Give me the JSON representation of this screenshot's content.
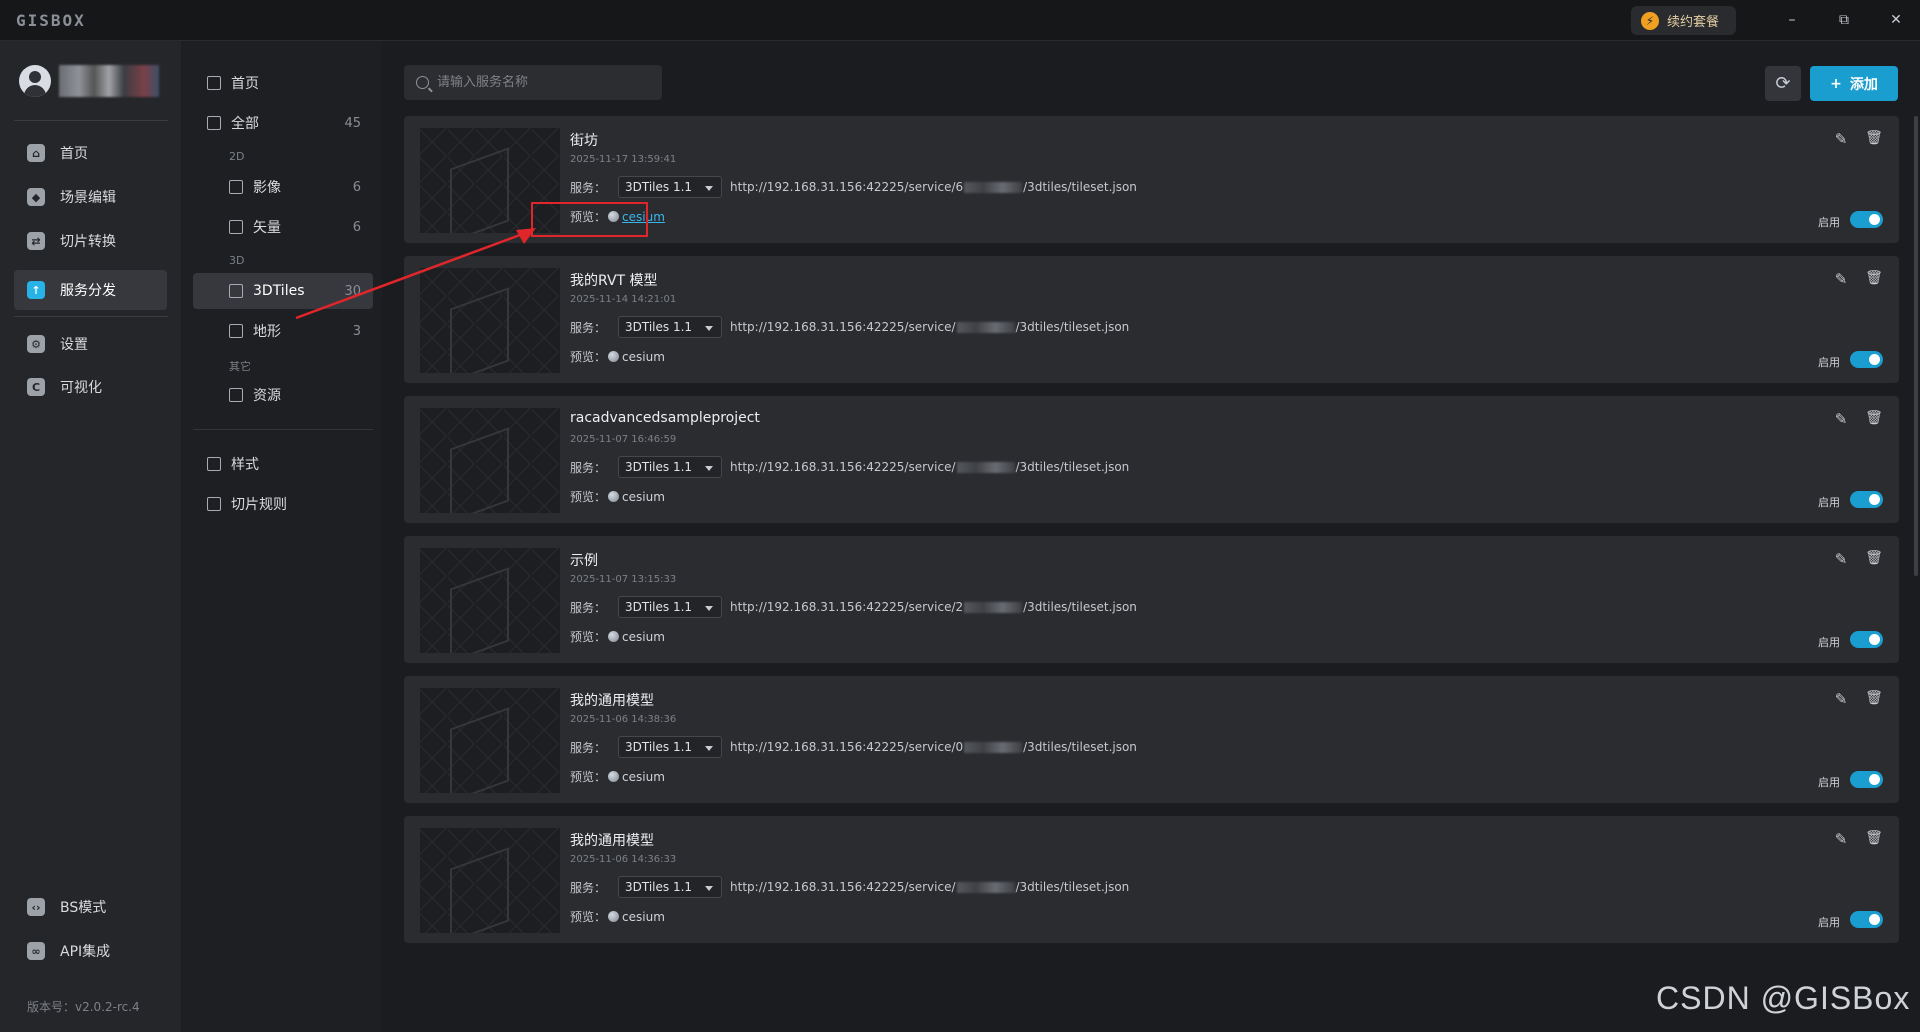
{
  "app": {
    "logo": "GISBOX",
    "renew_label": "续约套餐"
  },
  "window": {
    "minimize": "–",
    "maximize": "⧉",
    "close": "✕"
  },
  "leftnav": {
    "items": [
      {
        "label": "首页",
        "icon": "home-icon"
      },
      {
        "label": "场景编辑",
        "icon": "cube-icon"
      },
      {
        "label": "切片转换",
        "icon": "convert-icon"
      },
      {
        "label": "服务分发",
        "icon": "upload-icon"
      },
      {
        "label": "设置",
        "icon": "gear-icon"
      },
      {
        "label": "可视化",
        "icon": "visual-icon"
      }
    ],
    "bottom": [
      {
        "label": "BS模式",
        "icon": "code-icon"
      },
      {
        "label": "API集成",
        "icon": "link-icon"
      }
    ],
    "version": "版本号：v2.0.2-rc.4"
  },
  "catnav": {
    "home": "首页",
    "all": {
      "label": "全部",
      "count": "45"
    },
    "group_2d": "2D",
    "imagery": {
      "label": "影像",
      "count": "6"
    },
    "vector": {
      "label": "矢量",
      "count": "6"
    },
    "group_3d": "3D",
    "tiles3d": {
      "label": "3DTiles",
      "count": "30"
    },
    "terrain": {
      "label": "地形",
      "count": "3"
    },
    "group_other": "其它",
    "resources": "资源",
    "styles": "样式",
    "slice_rules": "切片规则"
  },
  "toolbar": {
    "search_placeholder": "请输入服务名称",
    "refresh": "⟳",
    "add_label": "添加",
    "add_icon": "+"
  },
  "cards": [
    {
      "title": "街坊",
      "date": "2025-11-17 13:59:41",
      "service_label": "服务：",
      "service_type": "3DTiles 1.1",
      "url_prefix": "http://192.168.31.156:42225/service/6",
      "url_suffix": "/3dtiles/tileset.json",
      "preview_label": "预览：",
      "preview_link": "cesium",
      "enabled_label": "启用",
      "enabled": true
    },
    {
      "title": "我的RVT 模型",
      "date": "2025-11-14 14:21:01",
      "service_label": "服务：",
      "service_type": "3DTiles 1.1",
      "url_prefix": "http://192.168.31.156:42225/service/",
      "url_suffix": "/3dtiles/tileset.json",
      "preview_label": "预览：",
      "preview_link": "cesium",
      "enabled_label": "启用",
      "enabled": true
    },
    {
      "title": "racadvancedsampleproject",
      "date": "2025-11-07 16:46:59",
      "service_label": "服务：",
      "service_type": "3DTiles 1.1",
      "url_prefix": "http://192.168.31.156:42225/service/",
      "url_suffix": "/3dtiles/tileset.json",
      "preview_label": "预览：",
      "preview_link": "cesium",
      "enabled_label": "启用",
      "enabled": true
    },
    {
      "title": "示例",
      "date": "2025-11-07 13:15:33",
      "service_label": "服务：",
      "service_type": "3DTiles 1.1",
      "url_prefix": "http://192.168.31.156:42225/service/2",
      "url_suffix": "/3dtiles/tileset.json",
      "preview_label": "预览：",
      "preview_link": "cesium",
      "enabled_label": "启用",
      "enabled": true
    },
    {
      "title": "我的通用模型",
      "date": "2025-11-06 14:38:36",
      "service_label": "服务：",
      "service_type": "3DTiles 1.1",
      "url_prefix": "http://192.168.31.156:42225/service/0",
      "url_suffix": "/3dtiles/tileset.json",
      "preview_label": "预览：",
      "preview_link": "cesium",
      "enabled_label": "启用",
      "enabled": true
    },
    {
      "title": "我的通用模型",
      "date": "2025-11-06 14:36:33",
      "service_label": "服务：",
      "service_type": "3DTiles 1.1",
      "url_prefix": "http://192.168.31.156:42225/service/",
      "url_suffix": "/3dtiles/tileset.json",
      "preview_label": "预览：",
      "preview_link": "cesium",
      "enabled_label": "启用",
      "enabled": true
    }
  ],
  "watermark": "CSDN @GISBox",
  "colors": {
    "accent": "#1a9ed0",
    "highlight": "#e0262b"
  }
}
